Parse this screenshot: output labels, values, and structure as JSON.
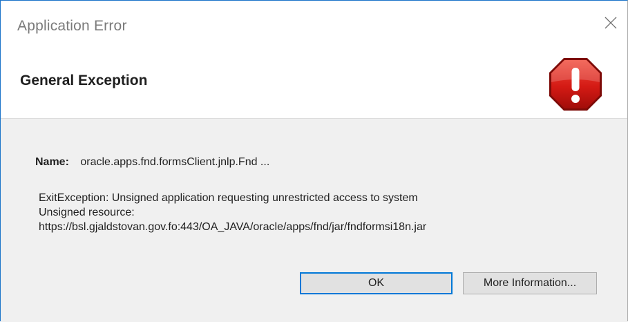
{
  "dialog": {
    "title": "Application Error",
    "header": "General Exception",
    "name_label": "Name:",
    "name_value": "oracle.apps.fnd.formsClient.jnlp.Fnd ...",
    "message_lines": [
      "ExitException: Unsigned application requesting unrestricted access to system",
      "Unsigned resource:",
      "https://bsl.gjaldstovan.gov.fo:443/OA_JAVA/oracle/apps/fnd/jar/fndformsi18n.jar"
    ],
    "buttons": {
      "ok_label": "OK",
      "more_label": "More Information..."
    },
    "icons": {
      "close": "close-icon",
      "error": "error-stop-icon"
    },
    "colors": {
      "error_red": "#d01818",
      "window_border": "#1a73c9",
      "focus_border": "#0078d7"
    }
  }
}
